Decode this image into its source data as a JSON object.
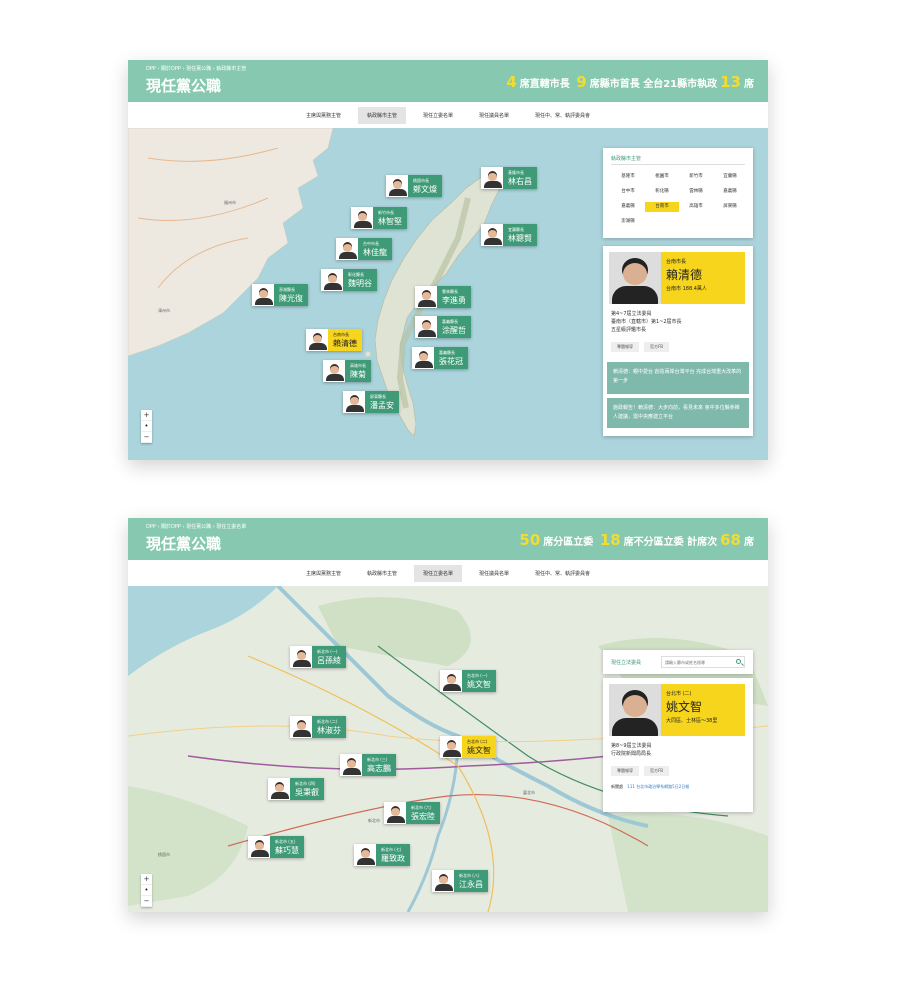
{
  "panel1": {
    "breadcrumb": "DPP › 關於DPP › 現任黨公職 › 執政縣市主管",
    "title": "現任黨公職",
    "stats": [
      {
        "num": "4",
        "label": "席直轄市長"
      },
      {
        "num": "9",
        "label": "席縣市首長"
      },
      {
        "num": "",
        "label": "全台21縣市執政"
      },
      {
        "num": "13",
        "label": "席"
      }
    ],
    "tabs": [
      "主席與黨務主管",
      "執政縣市主管",
      "現任立委名單",
      "現任議員名單",
      "現任中、常、執評委員會"
    ],
    "active_tab": 1,
    "markers": [
      {
        "role": "桃園市長",
        "name": "鄭文燦"
      },
      {
        "role": "基隆市長",
        "name": "林右昌"
      },
      {
        "role": "新竹市長",
        "name": "林智堅"
      },
      {
        "role": "宜蘭縣長",
        "name": "林聰賢"
      },
      {
        "role": "台中市長",
        "name": "林佳龍"
      },
      {
        "role": "彰化縣長",
        "name": "魏明谷"
      },
      {
        "role": "澎湖縣長",
        "name": "陳光復"
      },
      {
        "role": "雲林縣長",
        "name": "李進勇"
      },
      {
        "role": "嘉義縣長",
        "name": "涂醒哲"
      },
      {
        "role": "台南市長",
        "name": "賴清德"
      },
      {
        "role": "嘉義縣長",
        "name": "張花冠"
      },
      {
        "role": "高雄市長",
        "name": "陳菊"
      },
      {
        "role": "屏東縣長",
        "name": "潘孟安"
      }
    ],
    "filter": {
      "title": "執政縣市主管",
      "cities": [
        "基隆市",
        "桃園市",
        "新竹市",
        "宜蘭縣",
        "台中市",
        "彰化縣",
        "雲林縣",
        "嘉義縣",
        "嘉義縣",
        "台南市",
        "高雄市",
        "屏東縣",
        "澎湖縣"
      ],
      "active_index": 9
    },
    "detail": {
      "role": "台南市長",
      "name": "賴清德",
      "sub": "台南市 188.4萬人",
      "lines": [
        "第4~7屆立法委員",
        "臺南市（直轄市）第1~2屆市長",
        "五星級評鑑市長"
      ],
      "btn1": "專題報導",
      "btn2": "官方FB",
      "news1": "賴清德：親中愛台 創造兩岸台灣平台 完成台灣重大改革的第一步",
      "news2": "施政報告！賴清德：大步向前，看見未來 會中多位縣參推人建議，需中央應建立平台"
    },
    "zoom": [
      "+",
      "•",
      "−"
    ],
    "map_labels": {
      "fuzhou": "福州市",
      "zhangzhou": "漳州市"
    }
  },
  "panel2": {
    "breadcrumb": "DPP › 關於DPP › 現任黨公職 › 現任立委名單",
    "title": "現任黨公職",
    "stats": [
      {
        "num": "50",
        "label": "席分區立委"
      },
      {
        "num": "18",
        "label": "席不分區立委"
      },
      {
        "num": "",
        "label": "計席次"
      },
      {
        "num": "68",
        "label": "席"
      }
    ],
    "tabs": [
      "主席與黨務主管",
      "執政縣市主管",
      "現任立委名單",
      "現任議員名單",
      "現任中、常、執評委員會"
    ],
    "active_tab": 2,
    "markers": [
      {
        "role": "新北市 (一)",
        "name": "呂孫綾"
      },
      {
        "role": "台北市 (一)",
        "name": "姚文智"
      },
      {
        "role": "新北市 (二)",
        "name": "林淑芬"
      },
      {
        "role": "台北市 (二)",
        "name": "姚文智"
      },
      {
        "role": "新北市 (三)",
        "name": "高志鵬"
      },
      {
        "role": "新北市 (四)",
        "name": "吳秉叡"
      },
      {
        "role": "新北市 (六)",
        "name": "張宏陸"
      },
      {
        "role": "新北市 (五)",
        "name": "蘇巧慧"
      },
      {
        "role": "新北市 (七)",
        "name": "羅致政"
      },
      {
        "role": "新北市 (八)",
        "name": "江永昌"
      }
    ],
    "search": {
      "title": "現任立法委員",
      "placeholder": "請輸入縣市或姓名搜尋"
    },
    "detail": {
      "role": "台北市 (二)",
      "name": "姚文智",
      "sub": "大同區、士林區～38里",
      "lines": [
        "第8~9屆立法委員",
        "行政院新聞局局長"
      ],
      "btn1": "專題報導",
      "btn2": "官方FB",
      "link_label": "新聞處",
      "link_text": "111 台北市政治學系網路5日2日報"
    },
    "zoom": [
      "+",
      "•",
      "−"
    ],
    "map_labels": {
      "taoyuan": "桃園市",
      "taipei": "臺北市",
      "xinbei": "新北市"
    }
  },
  "colors": {
    "header": "#86c9b0",
    "accent_yellow": "#f7d51d",
    "marker_green": "#3f9a78",
    "sea": "#acd4dc"
  }
}
